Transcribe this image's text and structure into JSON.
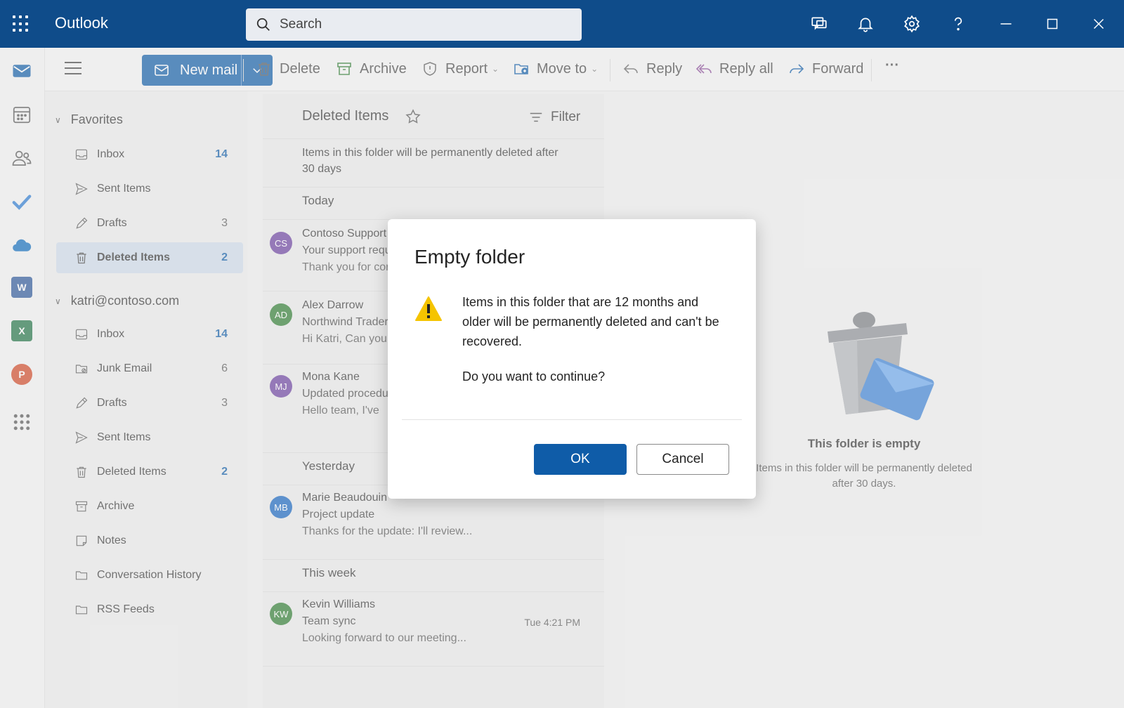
{
  "app": {
    "title": "Outlook"
  },
  "search": {
    "placeholder": "Search"
  },
  "toolbar": {
    "new_mail": "New mail",
    "delete": "Delete",
    "archive": "Archive",
    "report": "Report",
    "move_to": "Move to",
    "reply": "Reply",
    "reply_all": "Reply all",
    "forward": "Forward",
    "more": "···"
  },
  "folders": {
    "favorites": {
      "label": "Favorites",
      "items": [
        {
          "label": "Inbox",
          "count": "14"
        },
        {
          "label": "Sent Items",
          "count": ""
        },
        {
          "label": "Drafts",
          "count": "3"
        },
        {
          "label": "Deleted Items",
          "count": "2"
        }
      ]
    },
    "account": {
      "label": "katri@contoso.com",
      "items": [
        {
          "label": "Inbox",
          "count": "14"
        },
        {
          "label": "Junk Email",
          "count": "6"
        },
        {
          "label": "Drafts",
          "count": "3"
        },
        {
          "label": "Sent Items",
          "count": ""
        },
        {
          "label": "Deleted Items",
          "count": "2"
        },
        {
          "label": "Archive",
          "count": ""
        },
        {
          "label": "Notes",
          "count": ""
        },
        {
          "label": "Conversation History",
          "count": ""
        },
        {
          "label": "RSS Feeds",
          "count": ""
        }
      ]
    }
  },
  "message_list": {
    "title": "Deleted Items",
    "filter": "Filter",
    "notice": "Items in this folder will be permanently deleted after 30 days",
    "sections": {
      "today": "Today",
      "yesterday": "Yesterday",
      "this_week": "This week"
    },
    "messages": [
      {
        "initials": "CS",
        "sender": "Contoso Support",
        "subject": "Your support request",
        "preview": "Thank you for contacting",
        "time": "",
        "color": "#6b3fa0"
      },
      {
        "initials": "AD",
        "sender": "Alex Darrow",
        "subject": "Northwind Traders",
        "preview": "Hi Katri, Can you",
        "time": "",
        "color": "#2e7d32"
      },
      {
        "initials": "MJ",
        "sender": "Mona Kane",
        "subject": "Updated procedures",
        "preview": "Hello team, I've",
        "time": "",
        "color": "#6b3fa0"
      },
      {
        "initials": "MB",
        "sender": "Marie Beaudouin",
        "subject": "Project update",
        "preview": "Thanks for the update: I'll review...",
        "time": "",
        "color": "#1565c0"
      },
      {
        "initials": "KW",
        "sender": "Kevin Williams",
        "subject": "Team sync",
        "preview": "Looking forward to our meeting...",
        "time": "Tue 4:21 PM",
        "color": "#2e7d32"
      }
    ]
  },
  "reading_pane": {
    "empty_title": "This folder is empty",
    "empty_sub": "Items in this folder will be permanently deleted after 30 days."
  },
  "dialog": {
    "title": "Empty folder",
    "message": "Items in this folder that are 12 months and older will be permanently deleted and can't be recovered.",
    "question": "Do you want to continue?",
    "ok": "OK",
    "cancel": "Cancel"
  },
  "colors": {
    "titlebar": "#0f4c8a",
    "accent": "#0f5ca8",
    "warning": "#f5c400"
  }
}
